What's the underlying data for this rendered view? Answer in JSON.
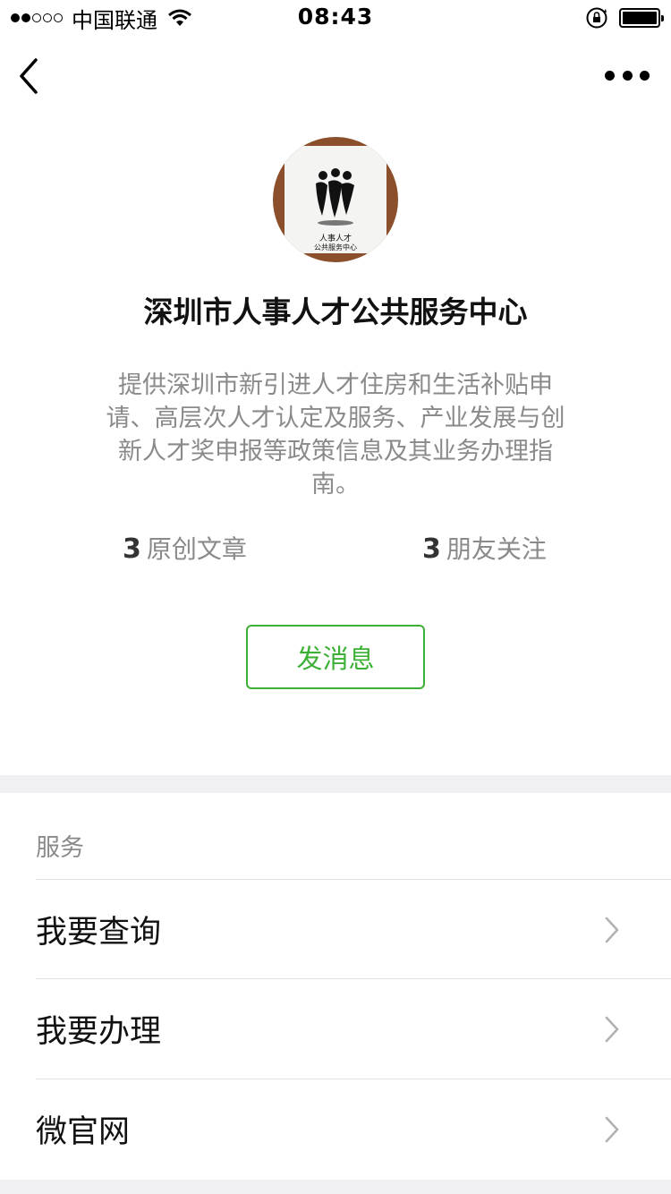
{
  "status_bar": {
    "carrier": "中国联通",
    "time": "08:43"
  },
  "profile": {
    "name": "深圳市人事人才公共服务中心",
    "logo_line1": "人事人才",
    "logo_line2": "公共服务中心",
    "description": "提供深圳市新引进人才住房和生活补贴申请、高层次人才认定及服务、产业发展与创新人才奖申报等政策信息及其业务办理指南。",
    "stats": [
      {
        "count": "3",
        "label": "原创文章"
      },
      {
        "count": "3",
        "label": "朋友关注"
      }
    ],
    "message_button": "发消息"
  },
  "services": {
    "section_title": "服务",
    "items": [
      {
        "label": "我要查询"
      },
      {
        "label": "我要办理"
      },
      {
        "label": "微官网"
      }
    ]
  },
  "colors": {
    "accent": "#3cb034",
    "secondary_text": "#8a8a8a",
    "separator_bg": "#efeff4"
  },
  "icons": {
    "back": "chevron-left-icon",
    "more": "more-dots-icon",
    "row_arrow": "chevron-right-icon",
    "wifi": "wifi-icon",
    "rotation_lock": "rotation-lock-icon",
    "battery": "battery-icon"
  }
}
